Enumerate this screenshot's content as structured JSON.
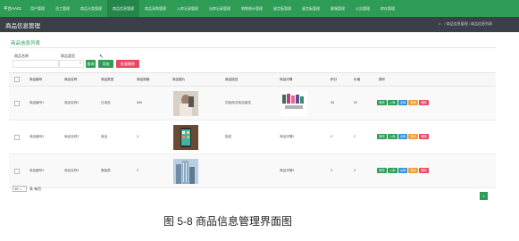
{
  "nav": {
    "brand": "平台AA01",
    "items": [
      "用户管理",
      "员工管理",
      "商品分类管理",
      "商品信息管理",
      "商品采购管理",
      "入库记录管理",
      "出库记录管理",
      "销售统计管理",
      "留言板管理",
      "留言板管理",
      "客服管理",
      "公告管理",
      "库存管理"
    ],
    "active_index": 3
  },
  "subbar": {
    "title": "商品信息管理",
    "breadcrumb": [
      "商品信息管理",
      "商品信息列表"
    ]
  },
  "panel": {
    "title": "商品信息列表"
  },
  "filters": {
    "name_label": "商品名称",
    "type_label": "商品类型",
    "type_value": "",
    "search_label": "查询",
    "add_label": "添加",
    "delete_label": "批量删除"
  },
  "table": {
    "headers": [
      "商品编号",
      "商品名称",
      "商品类型",
      "商品规格",
      "商品图片",
      "商品描述",
      "商品详情",
      "积分",
      "价格",
      "操作"
    ],
    "rows": [
      {
        "code": "商品编号1",
        "name": "商品名称1",
        "type": "日用品",
        "spec": "685",
        "desc": "初始测试商品描述",
        "detail": "",
        "points": "58",
        "price": "50"
      },
      {
        "code": "商品编号2",
        "name": "商品名称2",
        "type": "食品",
        "spec": "3",
        "desc": "描述",
        "detail": "商品详情2",
        "points": "2",
        "price": "2"
      },
      {
        "code": "商品编号3",
        "name": "商品名称3",
        "type": "服装类",
        "spec": "3",
        "desc": "",
        "detail": "商品详情3",
        "points": "3",
        "price": "3"
      }
    ],
    "ops": [
      {
        "label": "修改",
        "color": "#2e9c55"
      },
      {
        "label": "入库",
        "color": "#2e9c55"
      },
      {
        "label": "出库",
        "color": "#2f8ed0"
      },
      {
        "label": "评价",
        "color": "#f0a030"
      },
      {
        "label": "删除",
        "color": "#e8475f"
      }
    ]
  },
  "pager": {
    "page_size": "10",
    "per_page_text": "条 每页",
    "current_page": "1"
  },
  "caption": "图 5-8 商品信息管理界面图"
}
